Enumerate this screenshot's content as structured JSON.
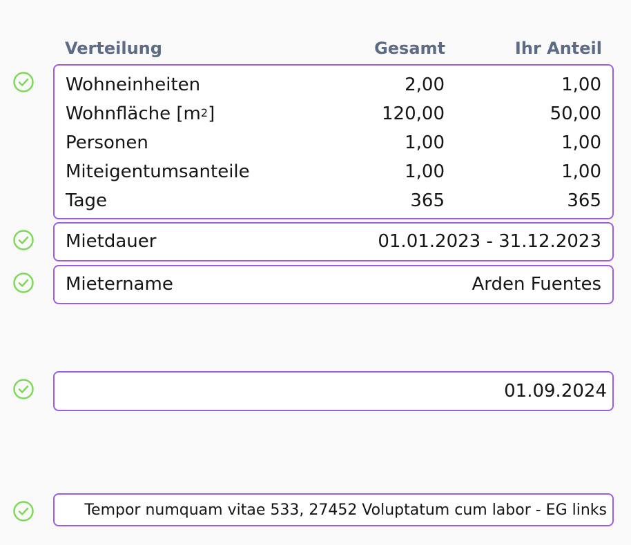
{
  "header": {
    "distribution": "Verteilung",
    "total": "Gesamt",
    "share": "Ihr Anteil"
  },
  "distribution": {
    "rows": [
      {
        "label": "Wohneinheiten",
        "total": "2,00",
        "share": "1,00"
      },
      {
        "label": "Wohnfläche [m",
        "label_sup": "2",
        "label_suffix": "]",
        "total": "120,00",
        "share": "50,00"
      },
      {
        "label": "Personen",
        "total": "1,00",
        "share": "1,00"
      },
      {
        "label": "Miteigentumsanteile",
        "total": "1,00",
        "share": "1,00"
      },
      {
        "label": "Tage",
        "total": "365",
        "share": "365"
      }
    ]
  },
  "rental_period": {
    "label": "Mietdauer",
    "value": "01.01.2023 - 31.12.2023"
  },
  "tenant": {
    "label": "Mietername",
    "value": "Arden Fuentes"
  },
  "date_field": {
    "value": "01.09.2024"
  },
  "address_field": {
    "value": "Tempor numquam vitae 533, 27452 Voluptatum cum labor - EG links"
  },
  "colors": {
    "border": "#9b5de5",
    "check": "#7ed957",
    "header_text": "#5d6b85"
  },
  "icons": {
    "status": "check-circle-icon"
  }
}
